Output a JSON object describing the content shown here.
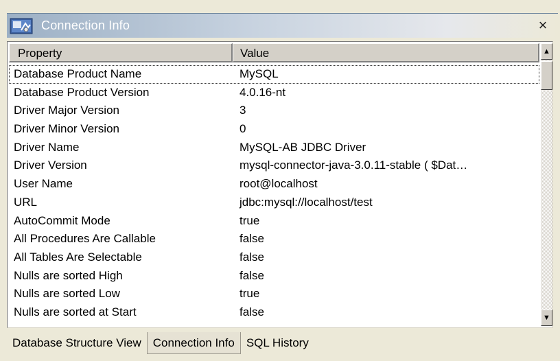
{
  "window": {
    "title": "Connection Info",
    "close_label": "×",
    "title_icon": "database-connection-icon"
  },
  "table": {
    "columns": [
      "Property",
      "Value"
    ],
    "rows": [
      {
        "property": "Database Product Name",
        "value": "MySQL"
      },
      {
        "property": "Database Product Version",
        "value": "4.0.16-nt"
      },
      {
        "property": "Driver Major Version",
        "value": "3"
      },
      {
        "property": "Driver Minor Version",
        "value": "0"
      },
      {
        "property": "Driver Name",
        "value": "MySQL-AB JDBC Driver"
      },
      {
        "property": "Driver Version",
        "value": "mysql-connector-java-3.0.11-stable ( $Dat…"
      },
      {
        "property": "User Name",
        "value": "root@localhost"
      },
      {
        "property": "URL",
        "value": "jdbc:mysql://localhost/test"
      },
      {
        "property": "AutoCommit Mode",
        "value": "true"
      },
      {
        "property": "All Procedures Are Callable",
        "value": "false"
      },
      {
        "property": "All Tables Are Selectable",
        "value": "false"
      },
      {
        "property": "Nulls are sorted High",
        "value": "false"
      },
      {
        "property": "Nulls are sorted Low",
        "value": "true"
      },
      {
        "property": "Nulls are sorted at Start",
        "value": "false"
      }
    ]
  },
  "scrollbar": {
    "up_arrow": "▲",
    "down_arrow": "▼"
  },
  "tabs": [
    {
      "label": "Database Structure View",
      "active": false
    },
    {
      "label": "Connection Info",
      "active": true
    },
    {
      "label": "SQL History",
      "active": false
    }
  ]
}
